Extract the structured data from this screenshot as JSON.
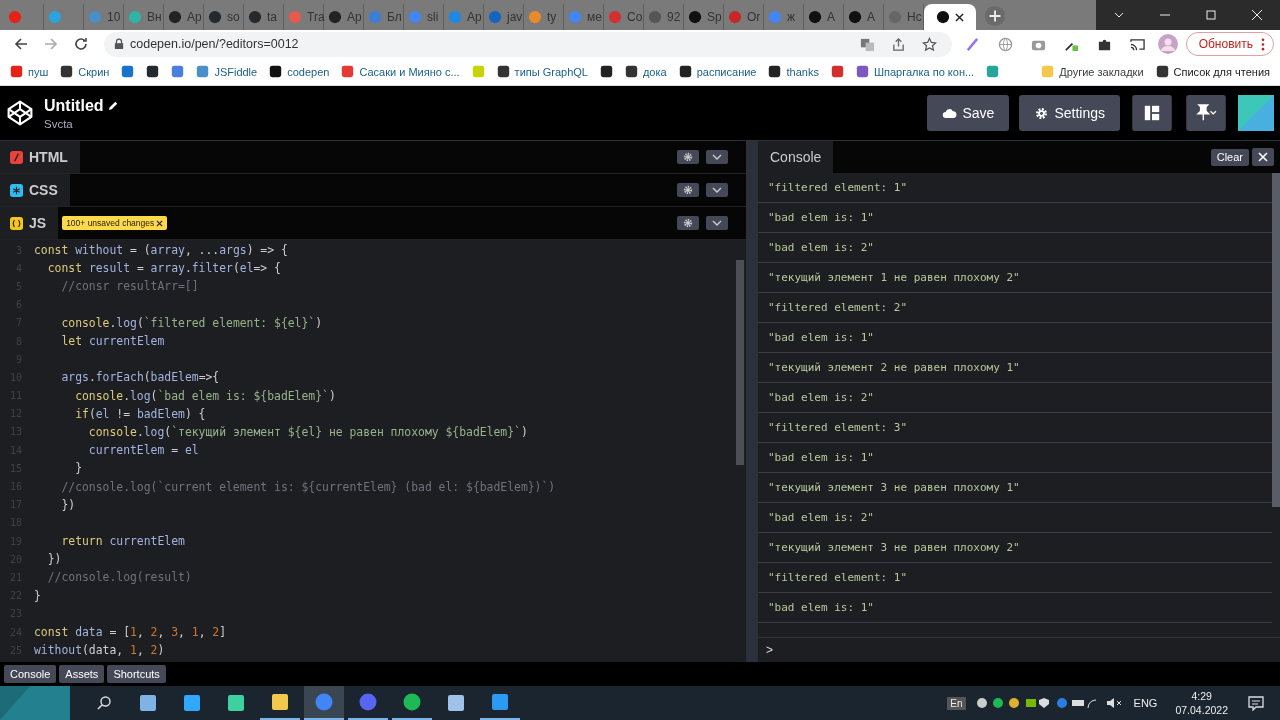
{
  "browser": {
    "tabs": [
      {
        "color": "#e62117",
        "selected": false
      },
      {
        "color": "#2aa3df",
        "selected": false
      },
      {
        "title": "10",
        "color": "#4a90c8",
        "selected": false
      },
      {
        "title": "Вн",
        "color": "#2fb5a8",
        "selected": false
      },
      {
        "title": "Ap",
        "color": "#222222",
        "selected": false
      },
      {
        "title": "so",
        "color": "#24292e",
        "selected": false
      },
      {
        "title": "ta",
        "color": "#24292e",
        "selected": false
      },
      {
        "title": "Tra",
        "color": "#e8584d",
        "selected": false
      },
      {
        "title": "Ap",
        "color": "#222222",
        "selected": false
      },
      {
        "title": "Бл",
        "color": "#3b7dd8",
        "selected": false
      },
      {
        "title": "sli",
        "color": "#4285f4",
        "selected": false
      },
      {
        "title": "Ap",
        "color": "#1e88e5",
        "selected": false
      },
      {
        "title": "jav",
        "color": "#1565c0",
        "selected": false
      },
      {
        "title": "ty",
        "color": "#e88a2a",
        "selected": false
      },
      {
        "title": "ме",
        "color": "#4285f4",
        "selected": false
      },
      {
        "title": "Co",
        "color": "#d32f2f",
        "selected": false
      },
      {
        "title": "92",
        "color": "#555555",
        "selected": false
      },
      {
        "title": "Sp",
        "color": "#111111",
        "selected": false
      },
      {
        "title": "Or",
        "color": "#c62828",
        "selected": false
      },
      {
        "title": "ж",
        "color": "#4285f4",
        "selected": false
      },
      {
        "title": "A",
        "color": "#111111",
        "selected": false
      },
      {
        "title": "A",
        "color": "#111111",
        "selected": false
      },
      {
        "title": "Hc",
        "color": "#666666",
        "selected": false
      },
      {
        "color": "#111111",
        "selected": true
      }
    ],
    "url": "codepen.io/pen/?editors=0012",
    "update_button": "Обновить",
    "bookmarks": [
      {
        "label": "пуш",
        "color": "#e62117"
      },
      {
        "label": "Скрин",
        "color": "#333333"
      },
      {
        "color": "#1a73c8"
      },
      {
        "color": "#24292e"
      },
      {
        "color": "#4a7fe0"
      },
      {
        "label": "JSFiddle",
        "color": "#4a90c8"
      },
      {
        "label": "codepen",
        "color": "#111111"
      },
      {
        "label": "Сасаки и Мияно с...",
        "color": "#e53935"
      },
      {
        "color": "#c8d400"
      },
      {
        "label": "типы GraphQL",
        "color": "#333333"
      },
      {
        "color": "#222222"
      },
      {
        "label": "дока",
        "color": "#333333"
      },
      {
        "label": "расписание",
        "color": "#222222"
      },
      {
        "label": "thanks",
        "color": "#222222"
      },
      {
        "color": "#d32f2f"
      },
      {
        "label": "Шпаргалка по кон...",
        "color": "#7e57c2"
      },
      {
        "color": "#26a69a"
      },
      {
        "label": "Другие закладки",
        "color": "#f2c94c"
      },
      {
        "label": "Список для чтения",
        "color": "#333333"
      }
    ]
  },
  "pen": {
    "title": "Untitled",
    "author": "Svcta",
    "buttons": {
      "save": "Save",
      "settings": "Settings"
    }
  },
  "editors": [
    {
      "kind": "html",
      "label": "HTML",
      "color": "#e8423c"
    },
    {
      "kind": "css",
      "label": "CSS",
      "color": "#2fbcf0"
    },
    {
      "kind": "js",
      "label": "JS",
      "color": "#f5c518",
      "badge": "100+ unsaved changes"
    }
  ],
  "code": [
    {
      "number": "3",
      "parts": [
        {
          "kind": "kw",
          "text": "const "
        },
        {
          "kind": "var",
          "text": "without "
        },
        {
          "kind": "p",
          "text": "= ("
        },
        {
          "kind": "var",
          "text": "array"
        },
        {
          "kind": "p",
          "text": ", ..."
        },
        {
          "kind": "var",
          "text": "args"
        },
        {
          "kind": "p",
          "text": ") => {"
        }
      ]
    },
    {
      "number": "4",
      "parts": [
        {
          "kind": "kw",
          "text": "  const "
        },
        {
          "kind": "var",
          "text": "result "
        },
        {
          "kind": "p",
          "text": "= "
        },
        {
          "kind": "var",
          "text": "array"
        },
        {
          "kind": "p",
          "text": "."
        },
        {
          "kind": "var",
          "text": "filter"
        },
        {
          "kind": "p",
          "text": "("
        },
        {
          "kind": "var",
          "text": "el"
        },
        {
          "kind": "p",
          "text": "=> {"
        }
      ]
    },
    {
      "number": "5",
      "parts": [
        {
          "kind": "c",
          "text": "    //consr resultArr=[]"
        }
      ]
    },
    {
      "number": "6"
    },
    {
      "number": "7",
      "parts": [
        {
          "kind": "kw",
          "text": "    console"
        },
        {
          "kind": "p",
          "text": "."
        },
        {
          "kind": "var",
          "text": "log"
        },
        {
          "kind": "p",
          "text": "("
        },
        {
          "kind": "s",
          "text": "`filtered element: ${el}`"
        },
        {
          "kind": "p",
          "text": ")"
        }
      ]
    },
    {
      "number": "8",
      "parts": [
        {
          "kind": "kw",
          "text": "    let "
        },
        {
          "kind": "var",
          "text": "currentElem"
        }
      ]
    },
    {
      "number": "9"
    },
    {
      "number": "10",
      "parts": [
        {
          "kind": "var",
          "text": "    args"
        },
        {
          "kind": "p",
          "text": "."
        },
        {
          "kind": "var",
          "text": "forEach"
        },
        {
          "kind": "p",
          "text": "("
        },
        {
          "kind": "var",
          "text": "badElem"
        },
        {
          "kind": "p",
          "text": "=>{"
        }
      ]
    },
    {
      "number": "11",
      "parts": [
        {
          "kind": "kw",
          "text": "      console"
        },
        {
          "kind": "p",
          "text": "."
        },
        {
          "kind": "var",
          "text": "log"
        },
        {
          "kind": "p",
          "text": "("
        },
        {
          "kind": "s",
          "text": "`bad elem is: ${badElem}`"
        },
        {
          "kind": "p",
          "text": ")"
        }
      ]
    },
    {
      "number": "12",
      "parts": [
        {
          "kind": "kw",
          "text": "      if"
        },
        {
          "kind": "p",
          "text": "("
        },
        {
          "kind": "var",
          "text": "el "
        },
        {
          "kind": "p",
          "text": "!= "
        },
        {
          "kind": "var",
          "text": "badElem"
        },
        {
          "kind": "p",
          "text": ") {"
        }
      ]
    },
    {
      "number": "13",
      "parts": [
        {
          "kind": "kw",
          "text": "        console"
        },
        {
          "kind": "p",
          "text": "."
        },
        {
          "kind": "var",
          "text": "log"
        },
        {
          "kind": "p",
          "text": "("
        },
        {
          "kind": "s",
          "text": "`текущий элемент ${el} не равен плохому ${badElem}`"
        },
        {
          "kind": "p",
          "text": ")"
        }
      ]
    },
    {
      "number": "14",
      "parts": [
        {
          "kind": "var",
          "text": "        currentElem "
        },
        {
          "kind": "p",
          "text": "= "
        },
        {
          "kind": "var",
          "text": "el"
        }
      ]
    },
    {
      "number": "15",
      "parts": [
        {
          "kind": "p",
          "text": "      }"
        }
      ]
    },
    {
      "number": "16",
      "parts": [
        {
          "kind": "c",
          "text": "    //console.log(`current element is: ${currentElem} (bad el: ${badElem})`)"
        }
      ]
    },
    {
      "number": "17",
      "parts": [
        {
          "kind": "p",
          "text": "    })"
        }
      ]
    },
    {
      "number": "18"
    },
    {
      "number": "19",
      "parts": [
        {
          "kind": "kw",
          "text": "    return "
        },
        {
          "kind": "var",
          "text": "currentElem"
        }
      ]
    },
    {
      "number": "20",
      "parts": [
        {
          "kind": "p",
          "text": "  })"
        }
      ]
    },
    {
      "number": "21",
      "parts": [
        {
          "kind": "c",
          "text": "  //console.log(result)"
        }
      ]
    },
    {
      "number": "22",
      "parts": [
        {
          "kind": "p",
          "text": "}"
        }
      ]
    },
    {
      "number": "23"
    },
    {
      "number": "24",
      "parts": [
        {
          "kind": "kw",
          "text": "const "
        },
        {
          "kind": "var",
          "text": "data "
        },
        {
          "kind": "p",
          "text": "= ["
        },
        {
          "kind": "n",
          "text": "1"
        },
        {
          "kind": "p",
          "text": ", "
        },
        {
          "kind": "n",
          "text": "2"
        },
        {
          "kind": "p",
          "text": ", "
        },
        {
          "kind": "n",
          "text": "3"
        },
        {
          "kind": "p",
          "text": ", "
        },
        {
          "kind": "n",
          "text": "1"
        },
        {
          "kind": "p",
          "text": ", "
        },
        {
          "kind": "n",
          "text": "2"
        },
        {
          "kind": "p",
          "text": "]"
        }
      ]
    },
    {
      "number": "25",
      "parts": [
        {
          "kind": "var",
          "text": "without"
        },
        {
          "kind": "p",
          "text": "(data, "
        },
        {
          "kind": "n",
          "text": "1"
        },
        {
          "kind": "p",
          "text": ", "
        },
        {
          "kind": "n",
          "text": "2"
        },
        {
          "kind": "p",
          "text": ")"
        }
      ]
    }
  ],
  "console": {
    "title": "Console",
    "clear": "Clear",
    "prompt": ">",
    "entries": [
      "\"filtered element: 1\"",
      "\"bad elem is: 1\"",
      "\"bad elem is: 2\"",
      "\"текущий элемент 1 не равен плохому 2\"",
      "\"filtered element: 2\"",
      "\"bad elem is: 1\"",
      "\"текущий элемент 2 не равен плохому 1\"",
      "\"bad elem is: 2\"",
      "\"filtered element: 3\"",
      "\"bad elem is: 1\"",
      "\"текущий элемент 3 не равен плохому 1\"",
      "\"bad elem is: 2\"",
      "\"текущий элемент 3 не равен плохому 2\"",
      "\"filtered element: 1\"",
      "\"bad elem is: 1\""
    ]
  },
  "footer": [
    "Console",
    "Assets",
    "Shortcuts"
  ],
  "taskbar": {
    "apps": [
      {
        "kind": "notepad",
        "running": false,
        "selected": false
      },
      {
        "kind": "ps",
        "running": false,
        "selected": false
      },
      {
        "kind": "ws",
        "running": false,
        "selected": false
      },
      {
        "kind": "folder",
        "running": true,
        "selected": false
      },
      {
        "kind": "chrome",
        "running": true,
        "selected": true
      },
      {
        "kind": "discord",
        "running": true,
        "selected": false
      },
      {
        "kind": "spotify",
        "running": true,
        "selected": false
      },
      {
        "kind": "book",
        "running": false,
        "selected": false
      },
      {
        "kind": "vscode",
        "running": true,
        "selected": false
      }
    ],
    "input_indicator": "En",
    "language": "ENG",
    "time": "4:29",
    "date": "07.04.2022"
  }
}
